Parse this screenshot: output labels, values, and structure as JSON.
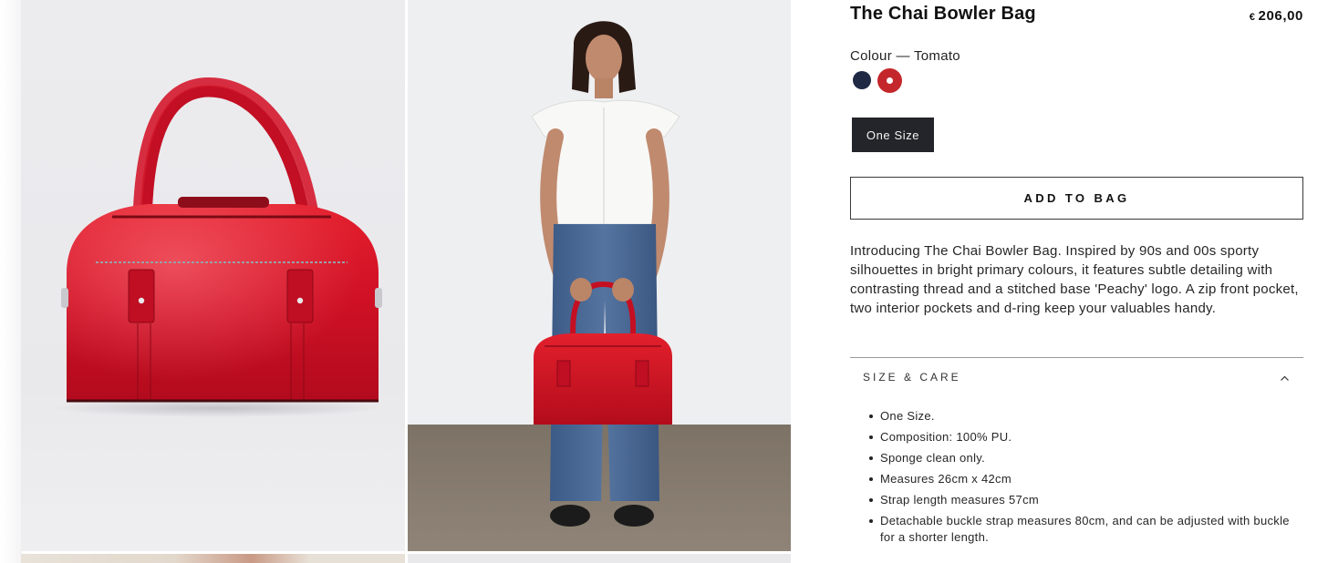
{
  "product": {
    "title": "The Chai Bowler Bag",
    "price_currency": "€",
    "price_amount": "206,00"
  },
  "colour": {
    "label": "Colour — Tomato",
    "swatches": [
      {
        "name": "Navy",
        "hex": "#1f2944",
        "selected": false
      },
      {
        "name": "Tomato",
        "hex": "#c4272b",
        "selected": true
      }
    ]
  },
  "size": {
    "selected_label": "One Size"
  },
  "cart": {
    "add_label": "ADD TO BAG"
  },
  "description": "Introducing The Chai Bowler Bag. Inspired by 90s and 00s sporty silhouettes in bright primary colours, it features subtle detailing with contrasting thread and a stitched base 'Peachy' logo. A zip front pocket, two interior pockets and d-ring keep your valuables handy.",
  "size_care": {
    "title": "SIZE & CARE",
    "expanded": true,
    "items": [
      "One Size.",
      "Composition: 100% PU.",
      "Sponge clean only.",
      "Measures 26cm x 42cm",
      "Strap length measures 57cm",
      "Detachable buckle strap measures 80cm, and can be adjusted with buckle for a shorter length."
    ]
  },
  "colors": {
    "bag_red": "#c8102e",
    "button_dark": "#23252a",
    "text": "#1c1c1c"
  },
  "icons": {
    "accordion_toggle": "chevron-up-icon"
  }
}
